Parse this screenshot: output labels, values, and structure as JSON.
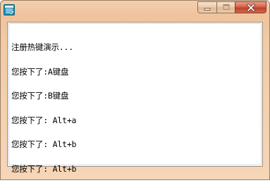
{
  "window": {
    "title": "",
    "icon": "app-window-icon",
    "controls": {
      "minimize": "minimize-icon",
      "maximize": "maximize-icon",
      "close": "close-icon"
    }
  },
  "output": {
    "lines": [
      "注册热键演示...",
      "您按下了:A键盘",
      "您按下了:B键盘",
      "您按下了: Alt+a",
      "您按下了: Alt+b",
      "您按下了: Alt+b"
    ]
  },
  "colors": {
    "titlebar": "#efc39c",
    "close_button": "#c0402a",
    "text": "#000000"
  }
}
